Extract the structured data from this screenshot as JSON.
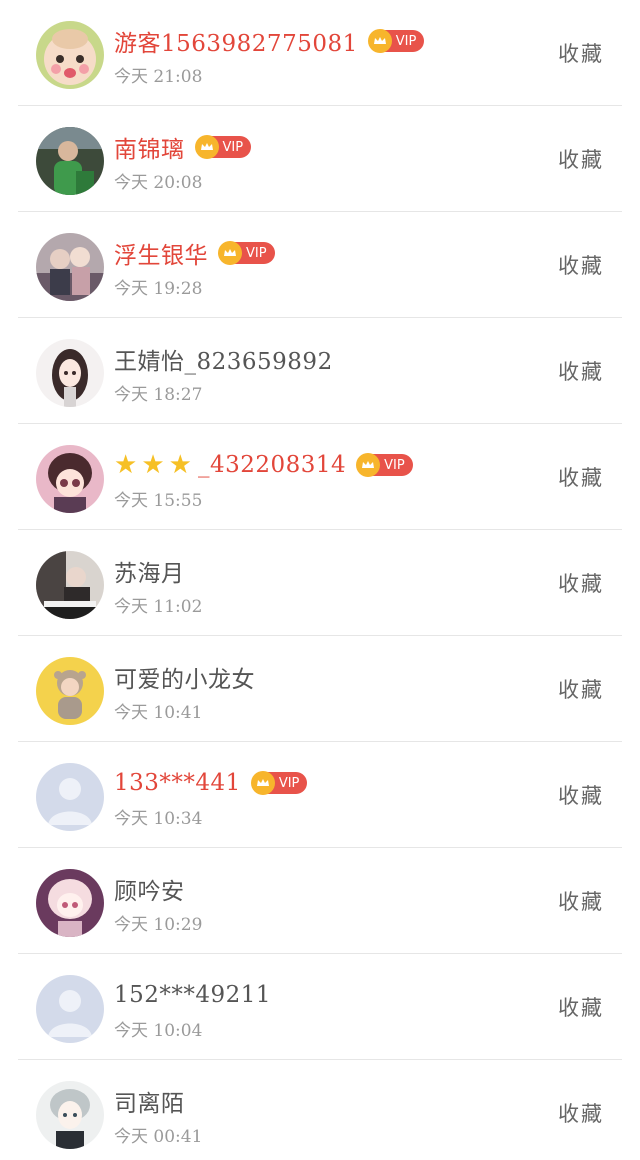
{
  "rows": [
    {
      "name": "游客1563982775081",
      "vip": true,
      "vip_label": "VIP",
      "time": "今天 21:08",
      "action": "收藏",
      "avatar": "cartoon-baby"
    },
    {
      "name": "南锦璃",
      "vip": true,
      "vip_label": "VIP",
      "time": "今天 20:08",
      "action": "收藏",
      "avatar": "child-green"
    },
    {
      "name": "浮生银华",
      "vip": true,
      "vip_label": "VIP",
      "time": "今天 19:28",
      "action": "收藏",
      "avatar": "couple-photo"
    },
    {
      "name": "王婧怡_823659892",
      "vip": false,
      "time": "今天 18:27",
      "action": "收藏",
      "avatar": "anime-girl-dark-hair"
    },
    {
      "name": "_432208314",
      "stars": 3,
      "vip": true,
      "vip_label": "VIP",
      "time": "今天 15:55",
      "action": "收藏",
      "avatar": "anime-girl-pink"
    },
    {
      "name": "苏海月",
      "vip": false,
      "time": "今天 11:02",
      "action": "收藏",
      "avatar": "piano-photo"
    },
    {
      "name": "可爱的小龙女",
      "vip": false,
      "time": "今天 10:41",
      "action": "收藏",
      "avatar": "baby-yellow"
    },
    {
      "name": "133***441",
      "vip": true,
      "vip_label": "VIP",
      "time": "今天 10:34",
      "action": "收藏",
      "avatar": "default-user"
    },
    {
      "name": "顾吟安",
      "vip": false,
      "time": "今天 10:29",
      "action": "收藏",
      "avatar": "anime-girl-blonde"
    },
    {
      "name": "152***49211",
      "vip": false,
      "time": "今天 10:04",
      "action": "收藏",
      "avatar": "default-user"
    },
    {
      "name": "司离陌",
      "vip": false,
      "time": "今天 00:41",
      "action": "收藏",
      "avatar": "anime-boy-silver"
    }
  ],
  "colors": {
    "vip_name": "#e2463a",
    "normal_name": "#555555",
    "time": "#9a9a9a",
    "vip_badge_bg": "#e8534a",
    "crown_bg": "#f7b52c",
    "star": "#f6c026",
    "divider": "#e6e6e6"
  }
}
